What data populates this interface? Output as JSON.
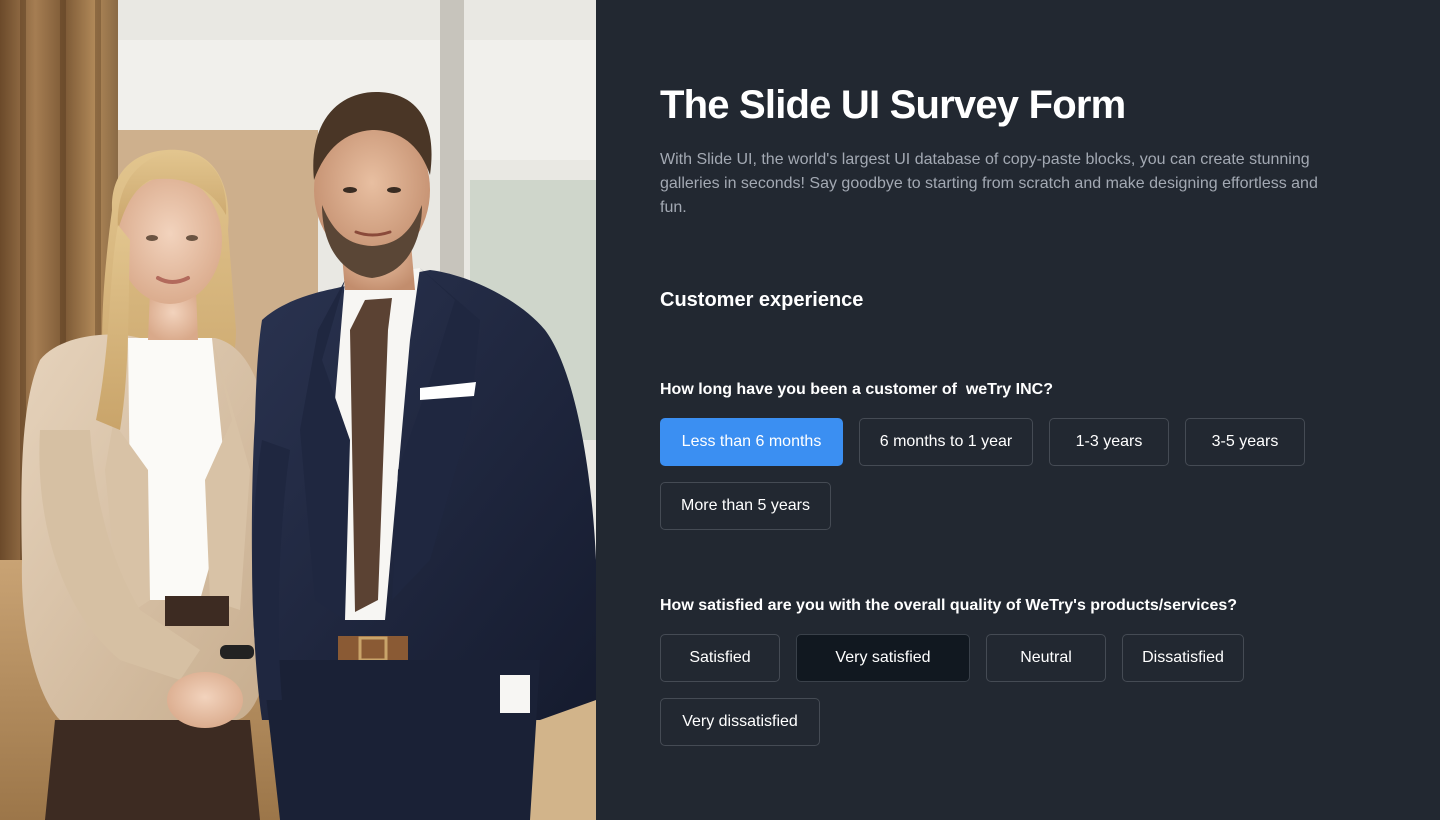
{
  "hero": {
    "title": "The Slide UI Survey Form",
    "description": "With Slide UI, the world's largest UI database of copy-paste blocks, you can create stunning galleries in seconds! Say goodbye to starting from scratch and make designing effortless and fun."
  },
  "section": {
    "title": "Customer experience"
  },
  "questions": [
    {
      "label": "How long have you been a customer of  weTry INC?",
      "selected": "Less than 6 months",
      "options": [
        "Less than 6 months",
        "6 months to 1 year",
        "1-3 years",
        "3-5 years",
        "More than 5 years"
      ]
    },
    {
      "label": "How satisfied are you with the overall quality of WeTry's products/services?",
      "selected": "Very satisfied",
      "options": [
        "Satisfied",
        "Very satisfied",
        "Neutral",
        "Dissatisfied",
        "Very dissatisfied"
      ]
    }
  ],
  "colors": {
    "background": "#222831",
    "accent": "#3b8ff2",
    "option_border": "#454b54",
    "pressed_option": "#111820",
    "description_text": "#a3a9b3"
  }
}
